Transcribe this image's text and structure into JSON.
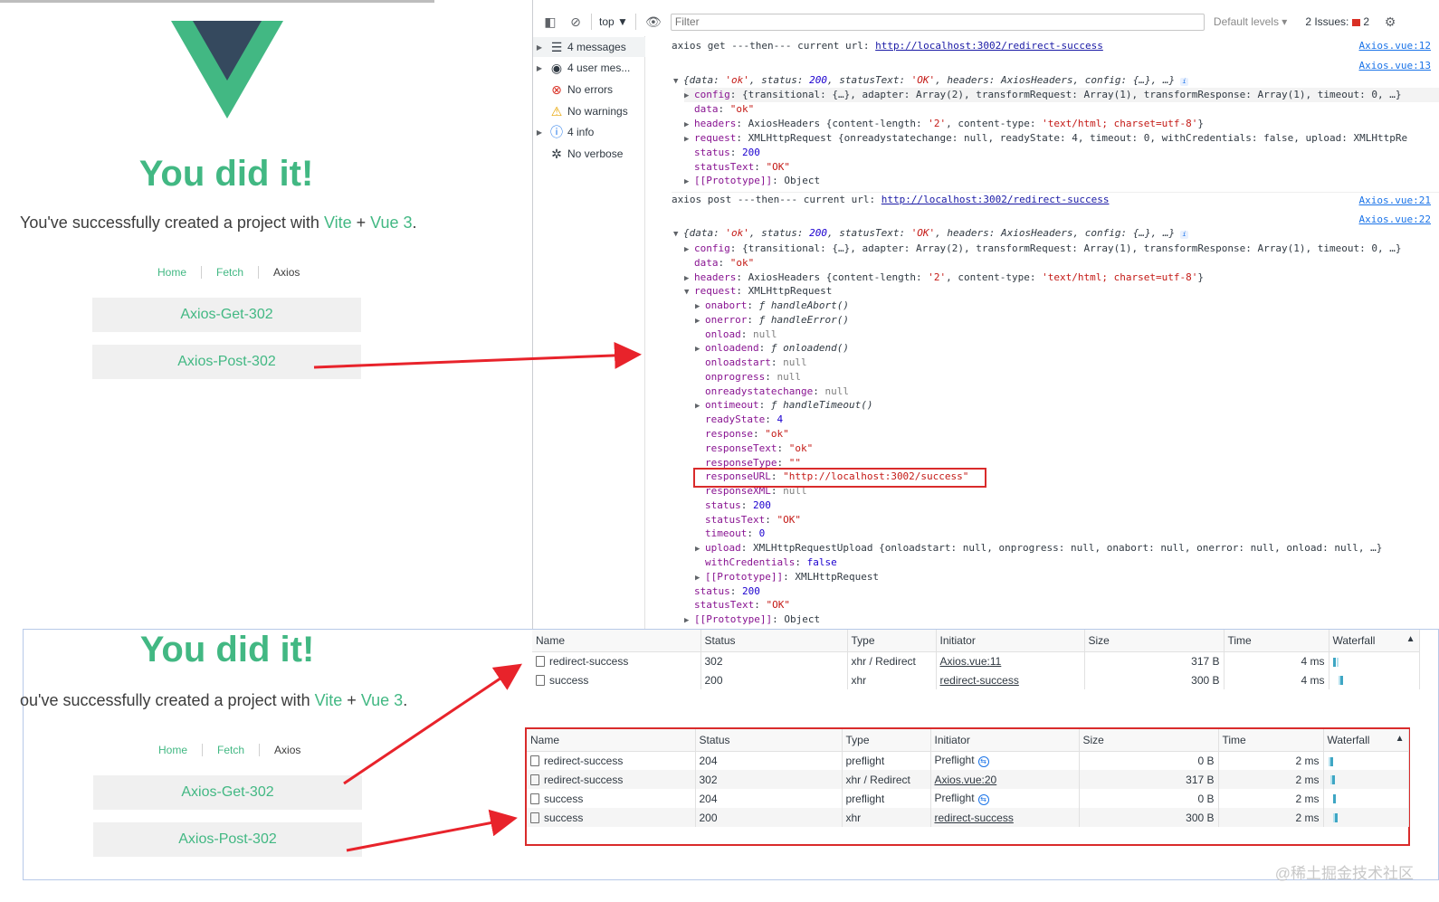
{
  "app": {
    "heading": "You did it!",
    "subtitle_pre": "You've successfully created a project with ",
    "subtitle_vite": "Vite",
    "subtitle_plus": " + ",
    "subtitle_vue": "Vue 3",
    "subtitle_end": ".",
    "subtitle_pre_cropped": "ou've successfully created a project with ",
    "nav": [
      "Home",
      "Fetch",
      "Axios"
    ],
    "buttons": [
      "Axios-Get-302",
      "Axios-Post-302"
    ],
    "logo_colors": {
      "outer": "#42b883",
      "inner": "#35495e"
    }
  },
  "devtools": {
    "context": "top",
    "filter_placeholder": "Filter",
    "default_levels": "Default levels",
    "issues_label": "2 Issues:",
    "issues_count": "2",
    "sidebar": [
      {
        "label": "4 messages",
        "icon": "list-icon"
      },
      {
        "label": "4 user mes...",
        "icon": "user-icon"
      },
      {
        "label": "No errors",
        "icon": "error-icon"
      },
      {
        "label": "No warnings",
        "icon": "warning-icon"
      },
      {
        "label": "4 info",
        "icon": "info-icon"
      },
      {
        "label": "No verbose",
        "icon": "bug-icon"
      }
    ],
    "log": {
      "get_msg": "axios get ---then--- current url: ",
      "url": "http://localhost:3002/redirect-success",
      "src12": "Axios.vue:12",
      "src13": "Axios.vue:13",
      "src21": "Axios.vue:21",
      "src22": "Axios.vue:22",
      "post_msg": "axios post ---then--- current url: ",
      "obj_summary_a": "{data: ",
      "obj_summary_b": "'ok'",
      "obj_summary_c": ", status: ",
      "obj_summary_d": "200",
      "obj_summary_e": ", statusText: ",
      "obj_summary_f": "'OK'",
      "obj_summary_g": ", headers: AxiosHeaders, config: {…}, …}",
      "config_val": "{transitional: {…}, adapter: Array(2), transformRequest: Array(1), transformResponse: Array(1), timeout: 0, …}",
      "headers_val": "AxiosHeaders {content-length: ",
      "headers_cl": "'2'",
      "headers_mid": ", content-type: ",
      "headers_ct": "'text/html; charset=utf-8'",
      "headers_end": "}",
      "request_collapsed": "XMLHttpRequest {onreadystatechange: null, readyState: 4, timeout: 0, withCredentials: false, upload: XMLHttpRe",
      "request_expanded": "XMLHttpRequest",
      "data_val": "\"ok\"",
      "status_val": "200",
      "statustext_val": "\"OK\"",
      "proto_object": "Object",
      "proto_xhr": "XMLHttpRequest",
      "onabort": "handleAbort()",
      "onerror": "handleError()",
      "onloadend": "onloadend()",
      "ontimeout": "handleTimeout()",
      "readystate": "4",
      "response": "\"ok\"",
      "responsetext": "\"ok\"",
      "responsetype": "\"\"",
      "responseurl": "\"http://localhost:3002/success\"",
      "timeout": "0",
      "upload_val": "XMLHttpRequestUpload {onloadstart: null, onprogress: null, onabort: null, onerror: null, onload: null, …}",
      "withcredentials": "false",
      "null": "null",
      "f": "ƒ"
    }
  },
  "network_get": {
    "columns": [
      "Name",
      "Status",
      "Type",
      "Initiator",
      "Size",
      "Time",
      "Waterfall"
    ],
    "rows": [
      {
        "name": "redirect-success",
        "status": "302",
        "type": "xhr / Redirect",
        "initiator": "Axios.vue:11",
        "size": "317 B",
        "time": "4 ms"
      },
      {
        "name": "success",
        "status": "200",
        "type": "xhr",
        "initiator": "redirect-success",
        "size": "300 B",
        "time": "4 ms"
      }
    ]
  },
  "network_post": {
    "columns": [
      "Name",
      "Status",
      "Type",
      "Initiator",
      "Size",
      "Time",
      "Waterfall"
    ],
    "rows": [
      {
        "name": "redirect-success",
        "status": "204",
        "type": "preflight",
        "initiator": "Preflight",
        "size": "0 B",
        "time": "2 ms"
      },
      {
        "name": "redirect-success",
        "status": "302",
        "type": "xhr / Redirect",
        "initiator": "Axios.vue:20",
        "size": "317 B",
        "time": "2 ms"
      },
      {
        "name": "success",
        "status": "204",
        "type": "preflight",
        "initiator": "Preflight",
        "size": "0 B",
        "time": "2 ms"
      },
      {
        "name": "success",
        "status": "200",
        "type": "xhr",
        "initiator": "redirect-success",
        "size": "300 B",
        "time": "2 ms"
      }
    ]
  },
  "watermark": "@稀土掘金技术社区",
  "colors": {
    "vue_green": "#42b883",
    "annotation_red": "#d92b2b",
    "link_blue": "#1a73e8"
  }
}
